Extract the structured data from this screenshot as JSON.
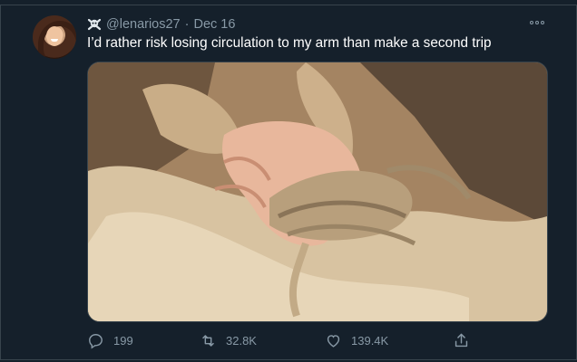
{
  "tweet": {
    "handle": "@lenarios27",
    "separator": "·",
    "date": "Dec 16",
    "text": "I’d rather risk losing circulation to my arm than make a second trip",
    "media_alt": "photo-hand-wrapped-in-plastic-grocery-bag-handles"
  },
  "actions": {
    "replies": "199",
    "retweets": "32.8K",
    "likes": "139.4K"
  },
  "icons": {
    "badge": "skull-crossbones-icon",
    "more": "more-dots-icon",
    "reply": "reply-icon",
    "retweet": "retweet-icon",
    "like": "heart-icon",
    "share": "share-icon"
  },
  "colors": {
    "background": "#15202b",
    "secondary_text": "#8899a6",
    "border": "#38444d"
  }
}
